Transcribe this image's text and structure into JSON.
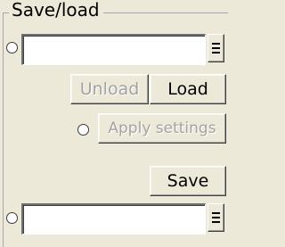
{
  "group": {
    "title": "Save/load"
  },
  "load_field": {
    "value": ""
  },
  "buttons": {
    "unload": "Unload",
    "load": "Load",
    "apply_settings": "Apply settings",
    "save": "Save"
  },
  "save_field": {
    "value": ""
  },
  "icons": {
    "radio": "radio-button",
    "menu": "hamburger-menu-icon"
  },
  "colors": {
    "background": "#ece9d8",
    "disabled_text": "#a3a3a3"
  }
}
